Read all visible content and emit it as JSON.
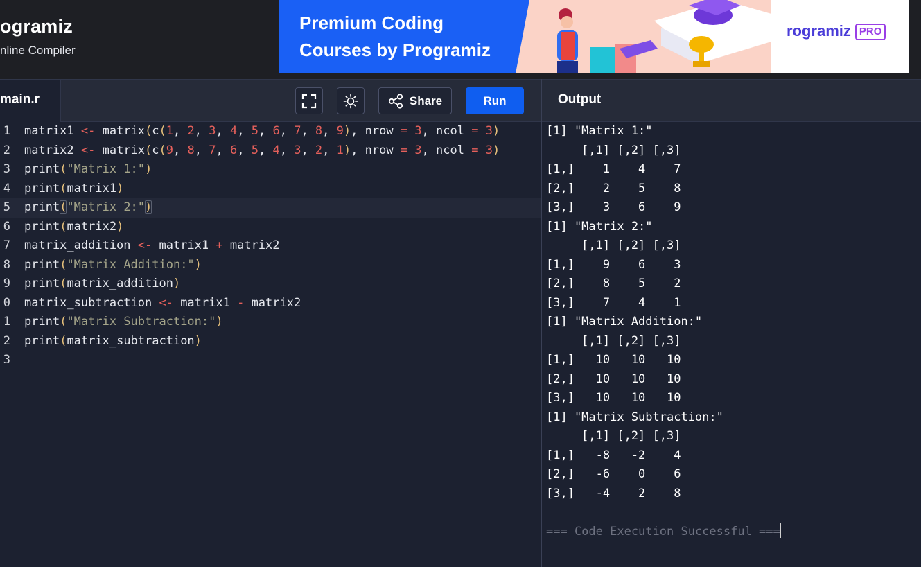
{
  "header": {
    "brand_name": "ogramiz",
    "brand_sub": "nline Compiler"
  },
  "banner": {
    "line1": "Premium Coding",
    "line2": "Courses by Programiz",
    "logo_text": "rogramiz",
    "logo_badge": "PRO",
    "colors": {
      "background": "#1a60f5",
      "accent": "#9a3fe6"
    }
  },
  "toolbar": {
    "file_tab": "main.r",
    "fullscreen_icon": "expand-icon",
    "theme_icon": "sun-icon",
    "share_label": "Share",
    "run_label": "Run",
    "output_title": "Output"
  },
  "editor": {
    "active_line": 5,
    "line_numbers": [
      "1",
      "2",
      "3",
      "4",
      "5",
      "6",
      "7",
      "8",
      "9",
      "0",
      "1",
      "2",
      "3"
    ],
    "lines": [
      "matrix1 <- matrix(c(1, 2, 3, 4, 5, 6, 7, 8, 9), nrow = 3, ncol = 3)",
      "matrix2 <- matrix(c(9, 8, 7, 6, 5, 4, 3, 2, 1), nrow = 3, ncol = 3)",
      "print(\"Matrix 1:\")",
      "print(matrix1)",
      "print(\"Matrix 2:\")",
      "print(matrix2)",
      "matrix_addition <- matrix1 + matrix2",
      "print(\"Matrix Addition:\")",
      "print(matrix_addition)",
      "matrix_subtraction <- matrix1 - matrix2",
      "print(\"Matrix Subtraction:\")",
      "print(matrix_subtraction)",
      ""
    ]
  },
  "output": {
    "lines": [
      "[1] \"Matrix 1:\"",
      "     [,1] [,2] [,3]",
      "[1,]    1    4    7",
      "[2,]    2    5    8",
      "[3,]    3    6    9",
      "[1] \"Matrix 2:\"",
      "     [,1] [,2] [,3]",
      "[1,]    9    6    3",
      "[2,]    8    5    2",
      "[3,]    7    4    1",
      "[1] \"Matrix Addition:\"",
      "     [,1] [,2] [,3]",
      "[1,]   10   10   10",
      "[2,]   10   10   10",
      "[3,]   10   10   10",
      "[1] \"Matrix Subtraction:\"",
      "     [,1] [,2] [,3]",
      "[1,]   -8   -2    4",
      "[2,]   -6    0    6",
      "[3,]   -4    2    8",
      ""
    ],
    "status": "=== Code Execution Successful ==="
  }
}
